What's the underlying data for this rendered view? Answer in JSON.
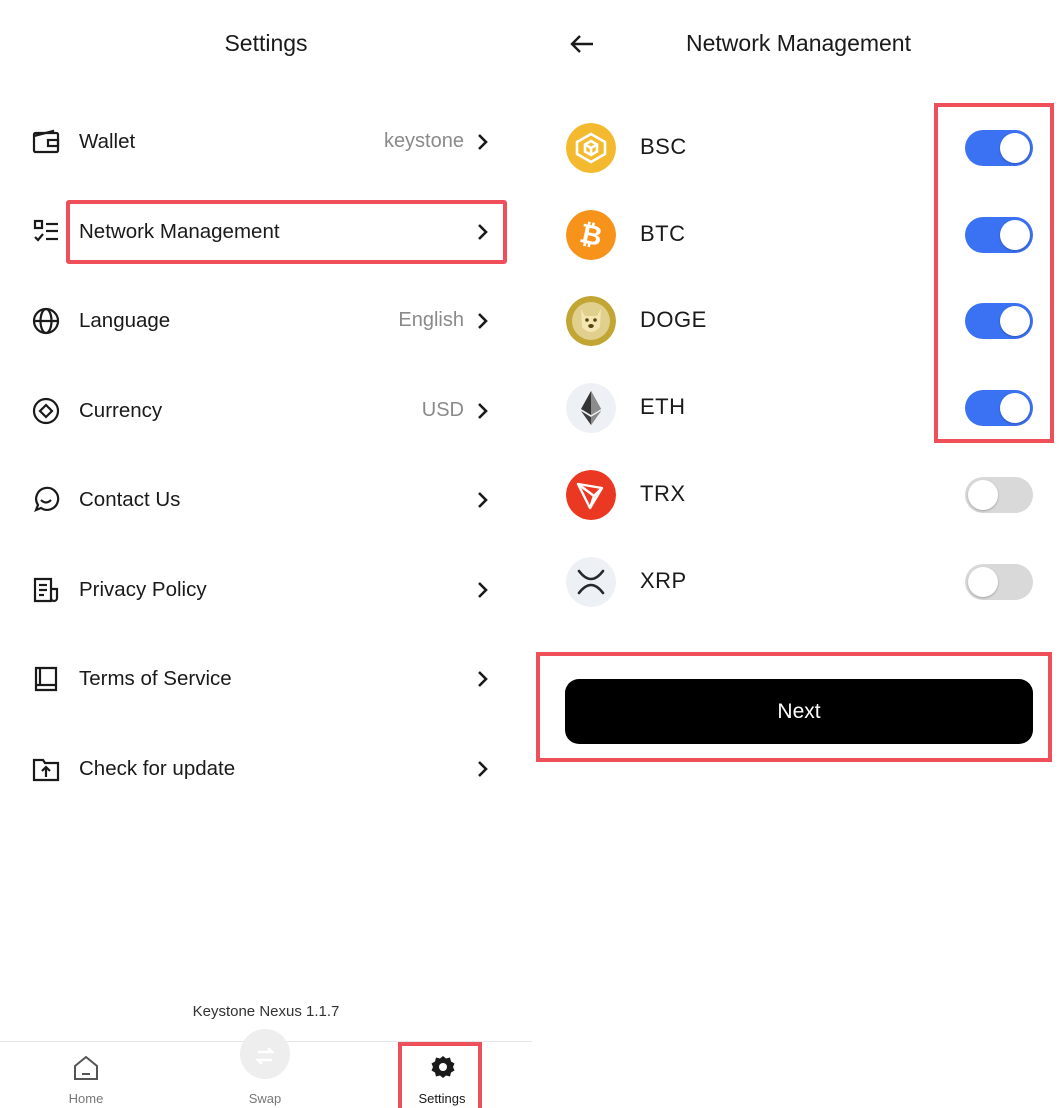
{
  "settings": {
    "title": "Settings",
    "items": [
      {
        "label": "Wallet",
        "value": "keystone",
        "icon": "wallet-icon"
      },
      {
        "label": "Network Management",
        "value": "",
        "icon": "checklist-icon"
      },
      {
        "label": "Language",
        "value": "English",
        "icon": "globe-icon"
      },
      {
        "label": "Currency",
        "value": "USD",
        "icon": "currency-icon"
      },
      {
        "label": "Contact Us",
        "value": "",
        "icon": "chat-icon"
      },
      {
        "label": "Privacy Policy",
        "value": "",
        "icon": "document-icon"
      },
      {
        "label": "Terms of Service",
        "value": "",
        "icon": "book-icon"
      },
      {
        "label": "Check for update",
        "value": "",
        "icon": "upload-folder-icon"
      }
    ],
    "version": "Keystone Nexus 1.1.7",
    "tabs": [
      {
        "label": "Home",
        "icon": "home-icon"
      },
      {
        "label": "Swap",
        "icon": "swap-icon"
      },
      {
        "label": "Settings",
        "icon": "gear-icon"
      }
    ]
  },
  "network": {
    "title": "Network Management",
    "coins": [
      {
        "name": "BSC",
        "enabled": true,
        "color": "#f3ba2f"
      },
      {
        "name": "BTC",
        "enabled": true,
        "color": "#f7931a"
      },
      {
        "name": "DOGE",
        "enabled": true,
        "color": "#c2a633"
      },
      {
        "name": "ETH",
        "enabled": true,
        "color": "#627eea"
      },
      {
        "name": "TRX",
        "enabled": false,
        "color": "#eb3823"
      },
      {
        "name": "XRP",
        "enabled": false,
        "color": "#23292f"
      }
    ],
    "next_label": "Next"
  },
  "colors": {
    "toggle_on": "#3b71f3",
    "toggle_off": "#d9d9d9",
    "highlight": "#ef4f58",
    "button": "#000000"
  }
}
